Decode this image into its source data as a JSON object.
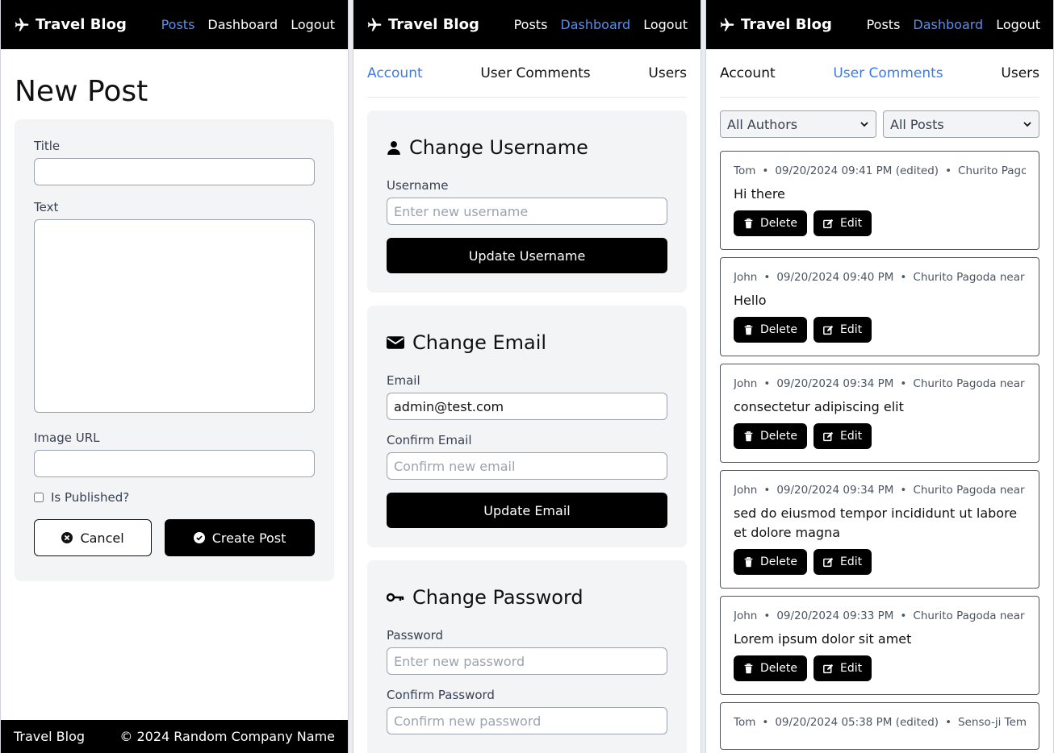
{
  "nav": {
    "brand": "Travel Blog",
    "links": [
      "Posts",
      "Dashboard",
      "Logout"
    ],
    "accent_color": "#5b8def"
  },
  "new_post": {
    "title": "New Post",
    "title_label": "Title",
    "text_label": "Text",
    "image_url_label": "Image URL",
    "published_label": "Is Published?",
    "cancel_label": "Cancel",
    "create_label": "Create Post"
  },
  "footer": {
    "left": "Travel Blog",
    "right": "© 2024 Random Company Name"
  },
  "dashboard": {
    "tabs": [
      "Account",
      "User Comments",
      "Users"
    ],
    "change_username": {
      "heading": "Change Username",
      "label": "Username",
      "placeholder": "Enter new username",
      "button": "Update Username"
    },
    "change_email": {
      "heading": "Change Email",
      "email_label": "Email",
      "email_value": "admin@test.com",
      "confirm_label": "Confirm Email",
      "confirm_placeholder": "Confirm new email",
      "button": "Update Email"
    },
    "change_password": {
      "heading": "Change Password",
      "password_label": "Password",
      "password_placeholder": "Enter new password",
      "confirm_label": "Confirm Password",
      "confirm_placeholder": "Confirm new password"
    }
  },
  "comments": {
    "author_filter": "All Authors",
    "post_filter": "All Posts",
    "delete_label": "Delete",
    "edit_label": "Edit",
    "items": [
      {
        "author": "Tom",
        "date": "09/20/2024 09:41 PM (edited)",
        "post": "Churito Pagoda",
        "text": "Hi there"
      },
      {
        "author": "John",
        "date": "09/20/2024 09:40 PM",
        "post": "Churito Pagoda near M",
        "text": "Hello"
      },
      {
        "author": "John",
        "date": "09/20/2024 09:34 PM",
        "post": "Churito Pagoda near M",
        "text": "consectetur adipiscing elit"
      },
      {
        "author": "John",
        "date": "09/20/2024 09:34 PM",
        "post": "Churito Pagoda near M",
        "text": "sed do eiusmod tempor incididunt ut labore et dolore magna"
      },
      {
        "author": "John",
        "date": "09/20/2024 09:33 PM",
        "post": "Churito Pagoda near M",
        "text": "Lorem ipsum dolor sit amet"
      },
      {
        "author": "Tom",
        "date": "09/20/2024 05:38 PM (edited)",
        "post": "Senso-ji Temple",
        "text": ""
      }
    ]
  }
}
